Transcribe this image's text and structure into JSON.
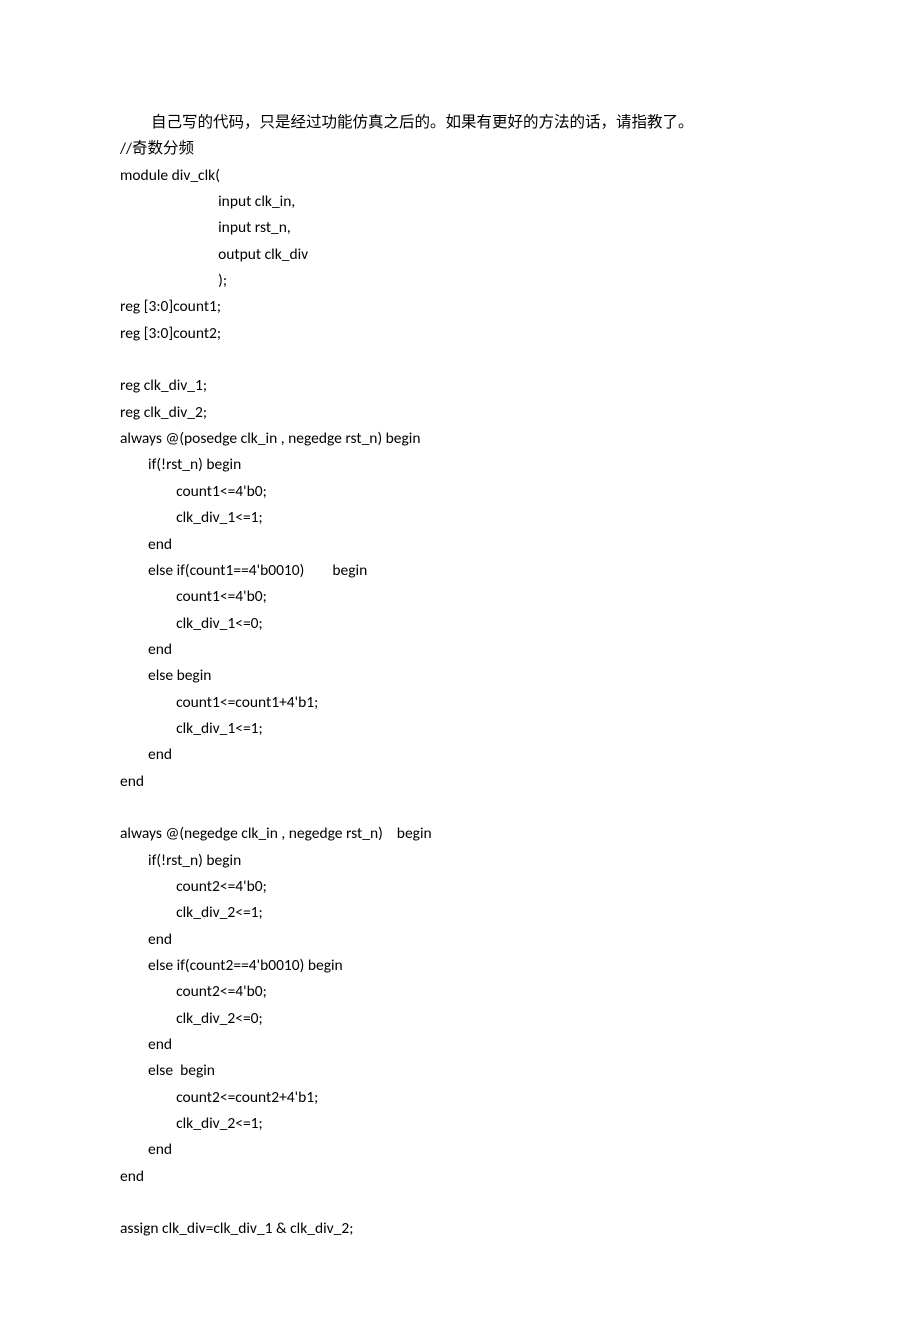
{
  "intro": "自己写的代码，只是经过功能仿真之后的。如果有更好的方法的话，请指教了。",
  "comment": "//奇数分频",
  "code": "module div_clk(\n                            input clk_in,\n                            input rst_n,\n                            output clk_div\n                            );\nreg [3:0]count1;\nreg [3:0]count2;\n\nreg clk_div_1;\nreg clk_div_2;\nalways @(posedge clk_in , negedge rst_n) begin\n        if(!rst_n) begin\n                count1<=4'b0;\n                clk_div_1<=1;\n        end\n        else if(count1==4'b0010)        begin\n                count1<=4'b0;\n                clk_div_1<=0;\n        end\n        else begin\n                count1<=count1+4'b1;\n                clk_div_1<=1;\n        end\nend\n\nalways @(negedge clk_in , negedge rst_n)    begin\n        if(!rst_n) begin\n                count2<=4'b0;\n                clk_div_2<=1;\n        end\n        else if(count2==4'b0010) begin\n                count2<=4'b0;\n                clk_div_2<=0;\n        end\n        else  begin\n                count2<=count2+4'b1;\n                clk_div_2<=1;\n        end\nend\n\nassign clk_div=clk_div_1 & clk_div_2;"
}
